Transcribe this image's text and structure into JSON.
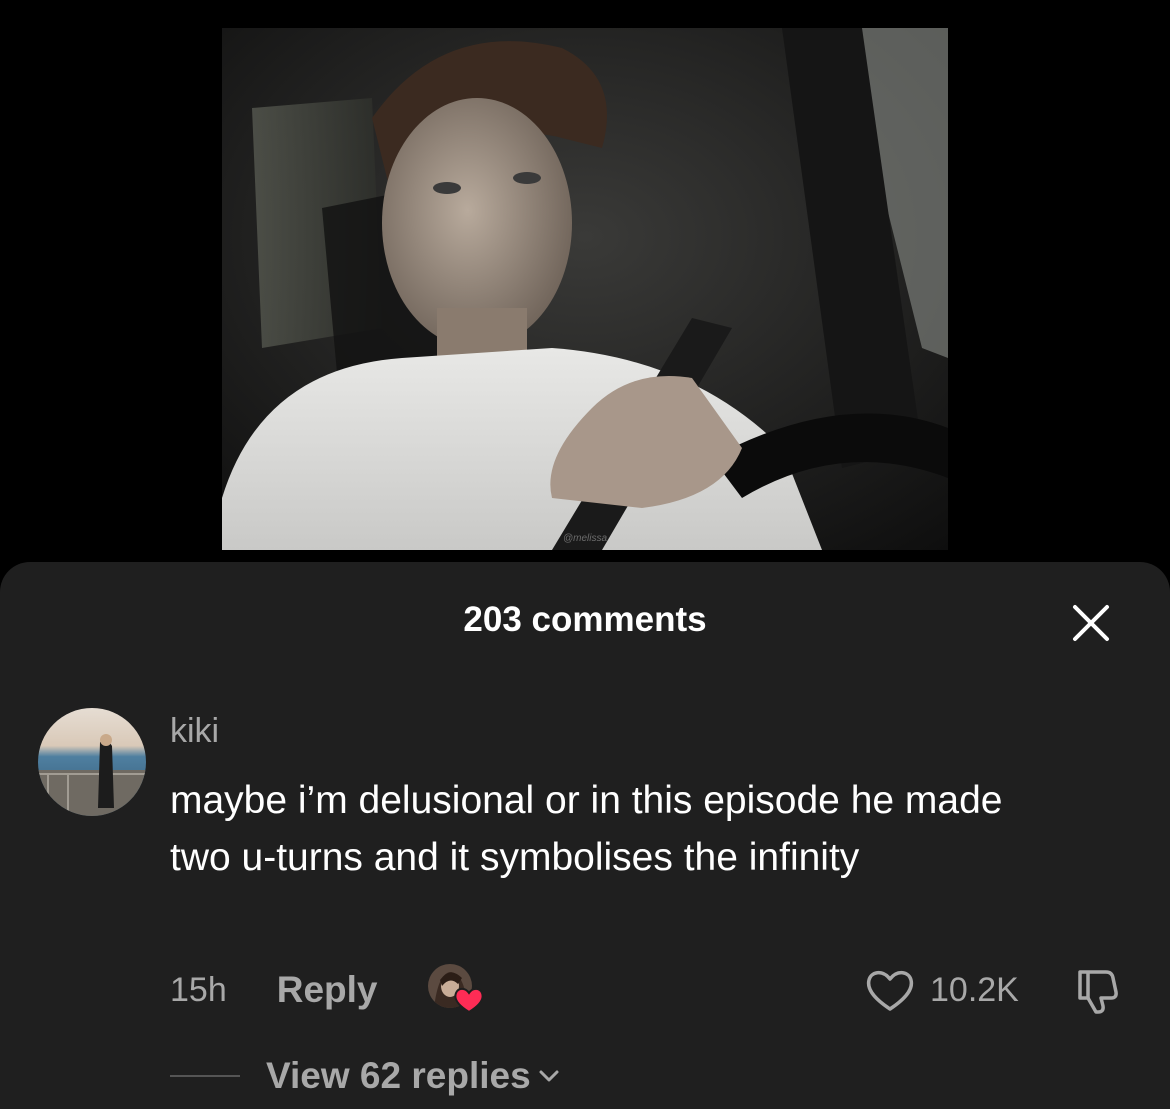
{
  "video": {
    "watermark": "@melissa"
  },
  "comments_sheet": {
    "title": "203 comments",
    "close_icon": "close-icon",
    "comment": {
      "username": "kiki",
      "text": "maybe i’m delusional or in this episode he made two u-turns and it symbolises the infinity",
      "time": "15h",
      "reply_label": "Reply",
      "like_count": "10.2K",
      "creator_liked": true,
      "view_replies_label": "View 62 replies"
    }
  },
  "colors": {
    "background": "#000000",
    "sheet": "#1f1f1f",
    "primary_text": "#ffffff",
    "secondary_text": "#a8a8a8",
    "heart_badge": "#fe2c55"
  }
}
